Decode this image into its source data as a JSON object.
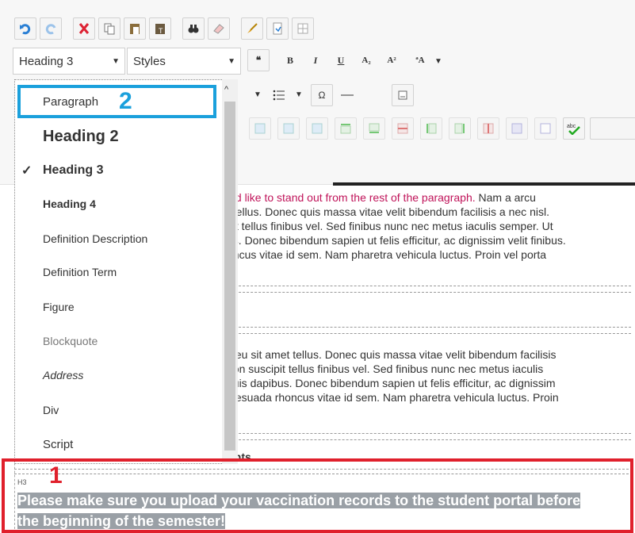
{
  "toolbar": {
    "block_format": "Heading 3",
    "styles_label": "Styles",
    "row1_icons": [
      "undo-icon",
      "redo-icon",
      "cut-icon",
      "copy-icon",
      "paste-icon",
      "paste-text-icon",
      "find-icon",
      "eraser-icon",
      "brush-icon",
      "source-icon",
      "table-icon"
    ],
    "row2_buttons": [
      "❝",
      "B",
      "I",
      "U",
      "A₂",
      "A²",
      "ªA"
    ]
  },
  "menu": {
    "items": [
      {
        "label": "Paragraph"
      },
      {
        "label": "Heading 2"
      },
      {
        "label": "Heading 3",
        "checked": true
      },
      {
        "label": "Heading 4"
      },
      {
        "label": "Definition Description"
      },
      {
        "label": "Definition Term"
      },
      {
        "label": "Figure"
      },
      {
        "label": "Blockquote"
      },
      {
        "label": "Address"
      },
      {
        "label": "Div"
      },
      {
        "label": "Script"
      }
    ],
    "check": "✓"
  },
  "content": {
    "para1": {
      "line1_pink": "uld like to stand out from the rest of the paragraph.",
      "line1_rest": " Nam a arcu",
      "line2": "t tellus. Donec quis massa vitae velit bibendum facilisis a nec nisl.",
      "line3": "pit tellus finibus vel. Sed finibus nunc nec metus iaculis semper. Ut",
      "line4": "us. Donec bibendum sapien ut felis efficitur, ac dignissim velit finibus.",
      "line5": "oncus vitae id sem. Nam pharetra vehicula luctus. Proin vel porta"
    },
    "para2": {
      "line1": "s eu sit amet tellus. Donec quis massa vitae velit bibendum facilisis",
      "line2": "non suscipit tellus finibus vel. Sed finibus nunc nec metus iaculis",
      "line3": "quis dapibus. Donec bibendum sapien ut felis efficitur, ac dignissim",
      "line4": "alesuada rhoncus vitae id sem. Nam pharetra vehicula luctus. Proin"
    },
    "cut_heading": "ents",
    "block_tag": "H3",
    "heading_line1": "Please make sure you upload your vaccination records to the student portal before",
    "heading_line2": "the beginning of the semester!"
  },
  "annotations": {
    "one": "1",
    "two": "2"
  },
  "colors": {
    "annotation_red": "#e0202c",
    "annotation_blue": "#1aa0dc",
    "pink_text": "#c0145a"
  }
}
